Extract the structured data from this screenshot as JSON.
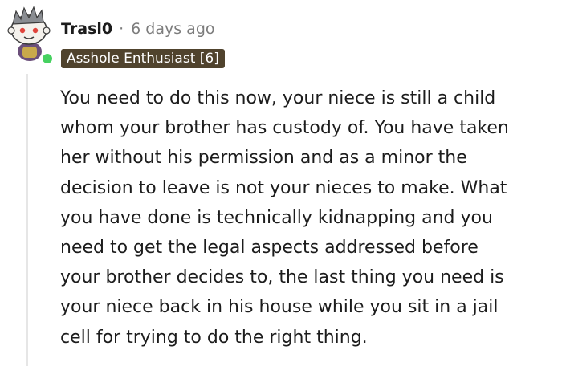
{
  "comment": {
    "username": "Trasl0",
    "separator": "·",
    "timestamp": "6 days ago",
    "flair": "Asshole Enthusiast [6]",
    "avatar_icon": "snoo-avatar-icon",
    "online_status": "online",
    "body_lines": [
      "You need to do this now, your niece is still a child",
      "whom your brother has custody of. You have taken",
      "her without his permission and as a minor the",
      "decision to leave is not your nieces to make. What",
      "you have done is technically kidnapping and you",
      "need to get the legal aspects addressed before",
      "your brother decides to, the last thing you need is",
      "your niece back in his house while you sit in a jail",
      "cell for trying to do the right thing."
    ]
  },
  "colors": {
    "flair_bg": "#50432d",
    "online": "#46d160",
    "meta_text": "#7c7c7c"
  }
}
